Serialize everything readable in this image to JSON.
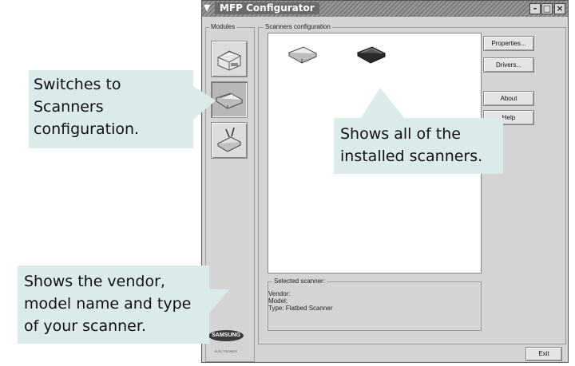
{
  "window": {
    "title": "MFP Configurator",
    "controls": {
      "minimize": "-",
      "maximize": "□",
      "close": "×"
    }
  },
  "modules": {
    "label": "Modules",
    "items": [
      {
        "name": "printer-module",
        "icon": "printer-icon"
      },
      {
        "name": "scanner-module",
        "icon": "scanner-icon",
        "active": true
      },
      {
        "name": "port-module",
        "icon": "port-icon"
      }
    ]
  },
  "scanners_config": {
    "label": "Scanners configuration",
    "scanners": [
      {
        "icon": "flatbed-scanner-icon",
        "selected": false
      },
      {
        "icon": "flatbed-scanner-dark-icon",
        "selected": true
      }
    ]
  },
  "buttons": {
    "properties": "Properties...",
    "drivers": "Drivers...",
    "about": "About",
    "help": "Help",
    "exit": "Exit"
  },
  "selected_scanner": {
    "label": "Selected scanner:",
    "vendor": "Vendor:",
    "model": "Model:",
    "type": "Type: Flatbed Scanner"
  },
  "brand": {
    "name": "SAMSUNG",
    "sub": "ELECTRONICS"
  },
  "callouts": {
    "switches": [
      "Switches to",
      "Scanners",
      "configuration."
    ],
    "shows_all": [
      "Shows all of the",
      "installed scanners."
    ],
    "shows_vendor": [
      "Shows the vendor,",
      "model name and type",
      "of your scanner."
    ]
  },
  "colors": {
    "callout_bg": "#dbeaea",
    "window_bg": "#d4d4d4"
  }
}
